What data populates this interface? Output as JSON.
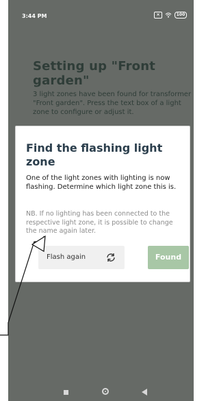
{
  "status_bar": {
    "time": "3:44 PM",
    "battery": "100"
  },
  "page": {
    "title": "Setting up \"Front garden\"",
    "intro": "3 light zones have been found for transformer \"Front garden\". Press the text box of a light zone to configure or adjust it."
  },
  "dialog": {
    "title": "Find the flashing light zone",
    "body": "One of the light zones with lighting is now flashing. Determine which light zone this is.",
    "note": "NB. If no lighting has been connected to the respective light zone, it is possible to change the name again later.",
    "flash_again_label": "Flash again",
    "found_label": "Found"
  },
  "icons": {
    "refresh": "refresh-icon",
    "recents": "recents-square-icon",
    "home": "home-circle-icon",
    "back": "back-triangle-icon"
  },
  "colors": {
    "overlay": "#666a66",
    "found_button": "#a8c7a6",
    "dialog_title": "#2c3f4d"
  }
}
